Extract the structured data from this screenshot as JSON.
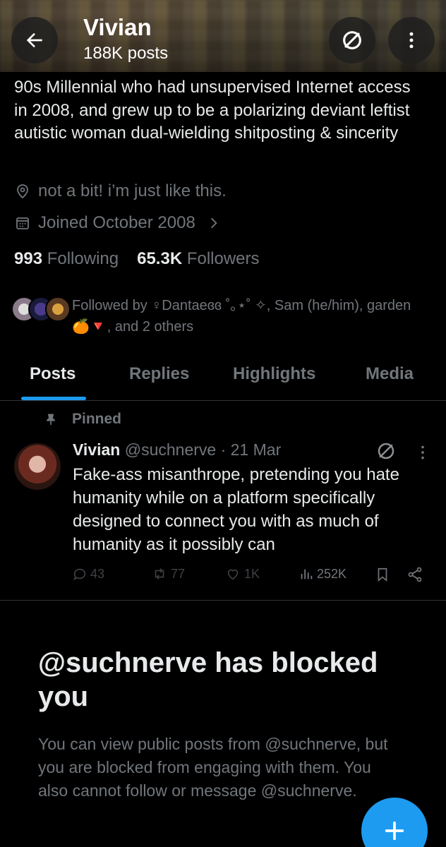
{
  "header": {
    "name": "Vivian",
    "posts_count": "188K posts"
  },
  "profile": {
    "bio": "90s Millennial who had unsupervised Internet access in 2008, and grew up to be a polarizing deviant leftist autistic woman dual-wielding shitposting & sincerity",
    "location": "not a bit! i’m just like this.",
    "joined": "Joined October 2008",
    "following_count": "993",
    "following_label": "Following",
    "followers_count": "65.3K",
    "followers_label": "Followers",
    "followed_by": "Followed by ♀Dantaeɞɞ ˚｡⋆˚ ✧, Sam (he/him), garden 🍊🔻, and 2 others"
  },
  "tabs": [
    {
      "label": "Posts",
      "active": true
    },
    {
      "label": "Replies",
      "active": false
    },
    {
      "label": "Highlights",
      "active": false
    },
    {
      "label": "Media",
      "active": false
    }
  ],
  "pinned_tweet": {
    "pinned_label": "Pinned",
    "author_name": "Vivian",
    "handle_date": "@suchnerve · 21 Mar",
    "text": "Fake-ass misanthrope, pretending you hate humanity while on a platform specifically designed to connect you with as much of humanity as it possibly can",
    "replies": "43",
    "reposts": "77",
    "likes": "1K",
    "views": "252K"
  },
  "blocked_notice": {
    "title": "@suchnerve has blocked you",
    "description": "You can view public posts from @suchnerve, but you are blocked from engaging with them. You also cannot follow or message @suchnerve."
  },
  "colors": {
    "accent": "#1d9bf0",
    "background": "#000000",
    "text_primary": "#e7e9ea",
    "text_secondary": "#71767b"
  },
  "icons": {
    "back": "arrow-left-icon",
    "blocked": "blocked-icon",
    "more": "more-vertical-icon",
    "location": "location-pin-icon",
    "calendar": "calendar-icon",
    "pin": "pin-icon",
    "fab": "plus-icon"
  }
}
